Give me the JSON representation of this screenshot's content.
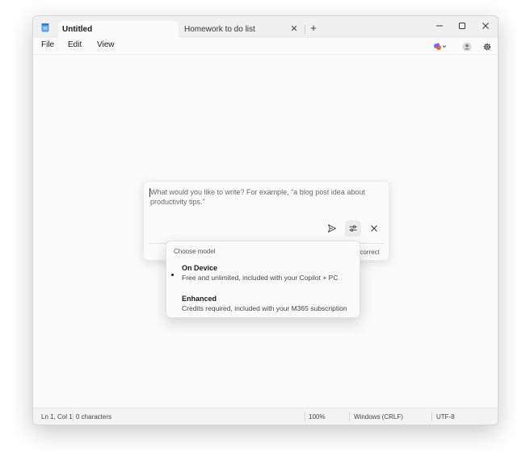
{
  "tabs": [
    {
      "label": "Untitled"
    },
    {
      "label": "Homework to do list"
    }
  ],
  "menu": {
    "file": "File",
    "edit": "Edit",
    "view": "View"
  },
  "icons": {
    "app": "notepad-icon",
    "close_tab": "close-icon",
    "new_tab": "plus-icon",
    "minimize": "minimize-icon",
    "maximize": "maximize-icon",
    "close": "close-icon",
    "copilot": "copilot-icon",
    "account": "account-icon",
    "settings": "gear-icon",
    "send": "send-icon",
    "options": "sliders-icon",
    "dismiss": "close-icon"
  },
  "symbols": {
    "close": "✕",
    "plus": "+"
  },
  "prompt": {
    "placeholder": "What would you like to write? For example, \"a blog post idea about productivity tips.\"",
    "partial_text": "ncorrect"
  },
  "model_menu": {
    "header": "Choose model",
    "options": [
      {
        "title": "On Device",
        "description": "Free and unlimited, included with your Copilot + PC",
        "selected": true
      },
      {
        "title": "Enhanced",
        "description": "Credits required, included with your M365 subscription",
        "selected": false
      }
    ]
  },
  "status": {
    "position": "Ln 1, Col 1",
    "characters": "0 characters",
    "zoom": "100%",
    "line_ending": "Windows (CRLF)",
    "encoding": "UTF-8"
  },
  "colors": {
    "accent": "#3b82d8",
    "copilot_a": "#4f7cf7",
    "copilot_b": "#f0683a"
  }
}
